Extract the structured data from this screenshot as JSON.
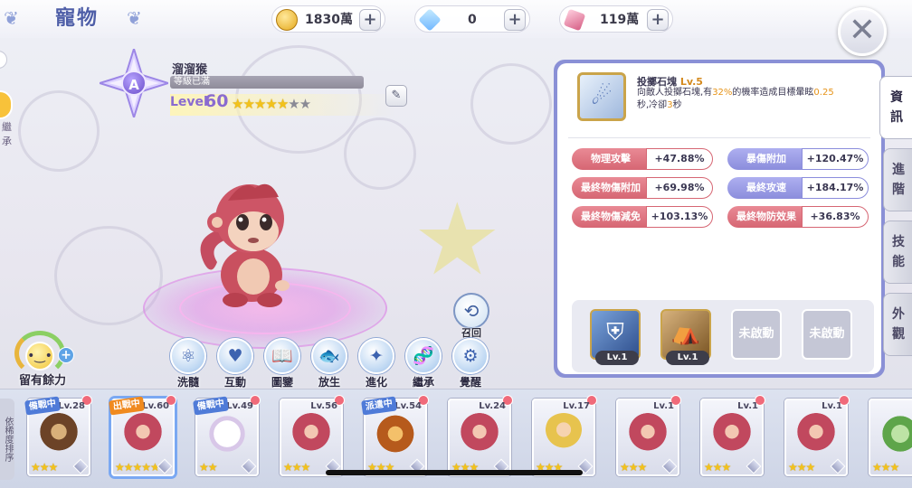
{
  "header": {
    "title": "寵物",
    "currencies": [
      {
        "icon": "gold-coin-icon",
        "value": "1830萬"
      },
      {
        "icon": "diamond-icon",
        "value": "0"
      },
      {
        "icon": "crystal-icon",
        "value": "119萬"
      }
    ],
    "plus_symbol": "+",
    "close_symbol": "✕"
  },
  "pet": {
    "rank": "A",
    "name": "溜溜猴",
    "exp_label": "等級已滿",
    "exp_fill": 1.0,
    "level_prefix": "Level",
    "level": "60",
    "stars_filled": 5,
    "stars_total": 7,
    "inherit_label": "繼承"
  },
  "spare_power": {
    "label": "留有餘力"
  },
  "recall": {
    "label": "召回"
  },
  "actions": [
    {
      "name": "wash",
      "label": "洗髓",
      "icon": "⚛"
    },
    {
      "name": "interact",
      "label": "互動",
      "icon": "♥"
    },
    {
      "name": "handbook",
      "label": "圖鑒",
      "icon": "📖"
    },
    {
      "name": "release",
      "label": "放生",
      "icon": "🐟"
    },
    {
      "name": "evolve",
      "label": "進化",
      "icon": "✦"
    },
    {
      "name": "inherit",
      "label": "繼承",
      "icon": "🧬"
    },
    {
      "name": "awaken",
      "label": "覺醒",
      "icon": "⚙"
    }
  ],
  "skill": {
    "name": "投擲石塊",
    "level": "Lv.5",
    "desc_1": "向敵人投擲石塊,有",
    "desc_pct": "32%",
    "desc_2": "的機率造成目標暈眩",
    "desc_sec": "0.25",
    "desc_3": "秒,冷卻",
    "desc_cd": "3",
    "desc_4": "秒"
  },
  "stats": [
    {
      "label": "物理攻擊",
      "value": "+47.88%",
      "color": "red"
    },
    {
      "label": "暴傷附加",
      "value": "+120.47%",
      "color": "purple"
    },
    {
      "label": "最終物傷附加",
      "value": "+69.98%",
      "color": "red"
    },
    {
      "label": "最終攻速",
      "value": "+184.17%",
      "color": "purple"
    },
    {
      "label": "最終物傷減免",
      "value": "+103.13%",
      "color": "red"
    },
    {
      "label": "最終物防效果",
      "value": "+36.83%",
      "color": "red"
    }
  ],
  "skill_slots": [
    {
      "type": "skill1",
      "level": "Lv.1",
      "icon": "armor-icon"
    },
    {
      "type": "skill2",
      "level": "Lv.1",
      "icon": "tent-up-icon"
    },
    {
      "type": "locked",
      "label": "未啟動"
    },
    {
      "type": "locked",
      "label": "未啟動"
    }
  ],
  "side_tabs": [
    "資訊",
    "進階",
    "技能",
    "外觀"
  ],
  "pet_list": {
    "strip_label": "依稀度排序",
    "cards": [
      {
        "level": "Lv.28",
        "art": "bear-a",
        "tag": "備戰中",
        "tag_color": "blue",
        "stars": "★★★"
      },
      {
        "level": "Lv.60",
        "art": "monkey-a",
        "tag": "出戰中",
        "tag_color": "orange",
        "stars": "★★★★★",
        "selected": true
      },
      {
        "level": "Lv.49",
        "art": "bunny-a",
        "tag": "備戰中",
        "tag_color": "blue",
        "stars": "★★"
      },
      {
        "level": "Lv.56",
        "art": "monkey-a",
        "tag": "",
        "stars": "★★★"
      },
      {
        "level": "Lv.54",
        "art": "lion-a",
        "tag": "派遣中",
        "tag_color": "blue",
        "stars": "★★★"
      },
      {
        "level": "Lv.24",
        "art": "monkey-a",
        "tag": "",
        "stars": "★★★"
      },
      {
        "level": "Lv.17",
        "art": "boy-a",
        "tag": "",
        "stars": "★★★"
      },
      {
        "level": "Lv.1",
        "art": "monkey-a",
        "tag": "",
        "stars": "★★★"
      },
      {
        "level": "Lv.1",
        "art": "monkey-a",
        "tag": "",
        "stars": "★★★"
      },
      {
        "level": "Lv.1",
        "art": "monkey-a",
        "tag": "",
        "stars": "★★★"
      },
      {
        "level": "",
        "art": "frog-a",
        "tag": "",
        "stars": "★★★"
      }
    ]
  },
  "colors": {
    "accent": "#8a90d6",
    "stat_red": "#d66673",
    "stat_purple": "#8b8ddc",
    "highlight": "#e69318"
  }
}
